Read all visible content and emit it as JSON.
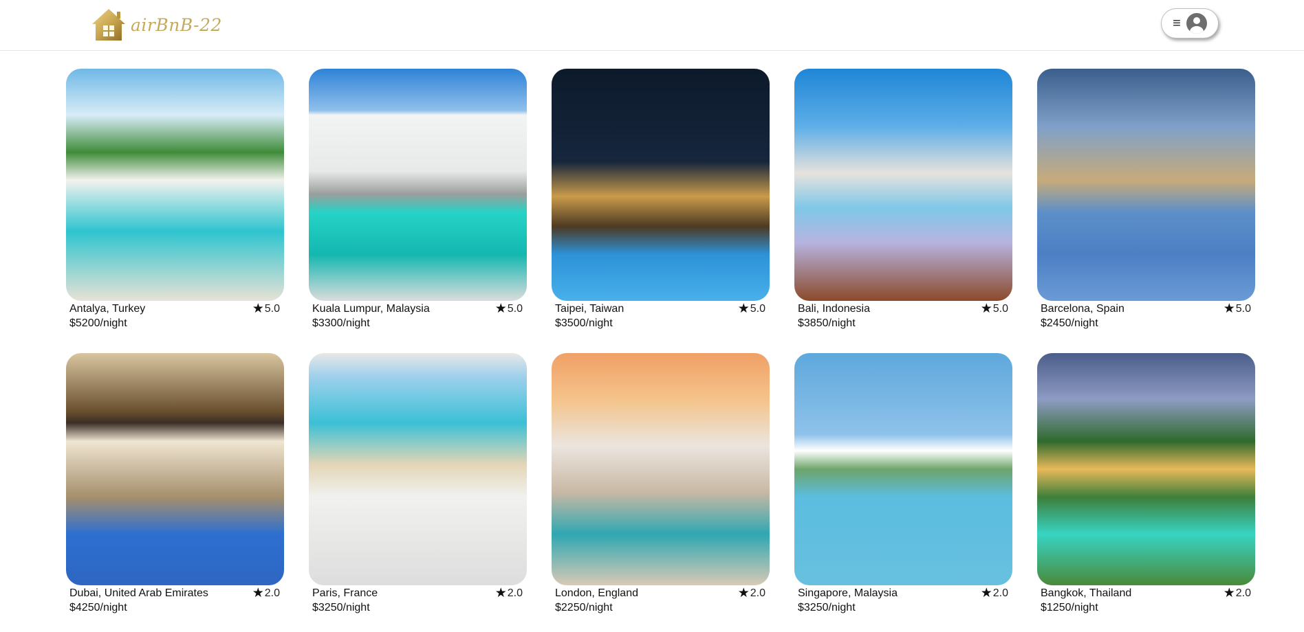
{
  "header": {
    "brand_name": "airBnB-22"
  },
  "listings": [
    {
      "location": "Antalya, Turkey",
      "price": "$5200/night",
      "rating": "5.0"
    },
    {
      "location": "Kuala Lumpur, Malaysia",
      "price": "$3300/night",
      "rating": "5.0"
    },
    {
      "location": "Taipei, Taiwan",
      "price": "$3500/night",
      "rating": "5.0"
    },
    {
      "location": "Bali, Indonesia",
      "price": "$3850/night",
      "rating": "5.0"
    },
    {
      "location": "Barcelona, Spain",
      "price": "$2450/night",
      "rating": "5.0"
    },
    {
      "location": "Dubai, United Arab Emirates",
      "price": "$4250/night",
      "rating": "2.0"
    },
    {
      "location": "Paris, France",
      "price": "$3250/night",
      "rating": "2.0"
    },
    {
      "location": "London, England",
      "price": "$2250/night",
      "rating": "2.0"
    },
    {
      "location": "Singapore, Malaysia",
      "price": "$3250/night",
      "rating": "2.0"
    },
    {
      "location": "Bangkok, Thailand",
      "price": "$1250/night",
      "rating": "2.0"
    }
  ],
  "icons": {
    "logo": "house-logo-icon",
    "menu": "hamburger-menu-icon",
    "user": "user-avatar-icon",
    "rating": "star-icon"
  },
  "colors": {
    "brand": "#c5a95c",
    "text": "#111111",
    "border": "#e6e6e6"
  }
}
